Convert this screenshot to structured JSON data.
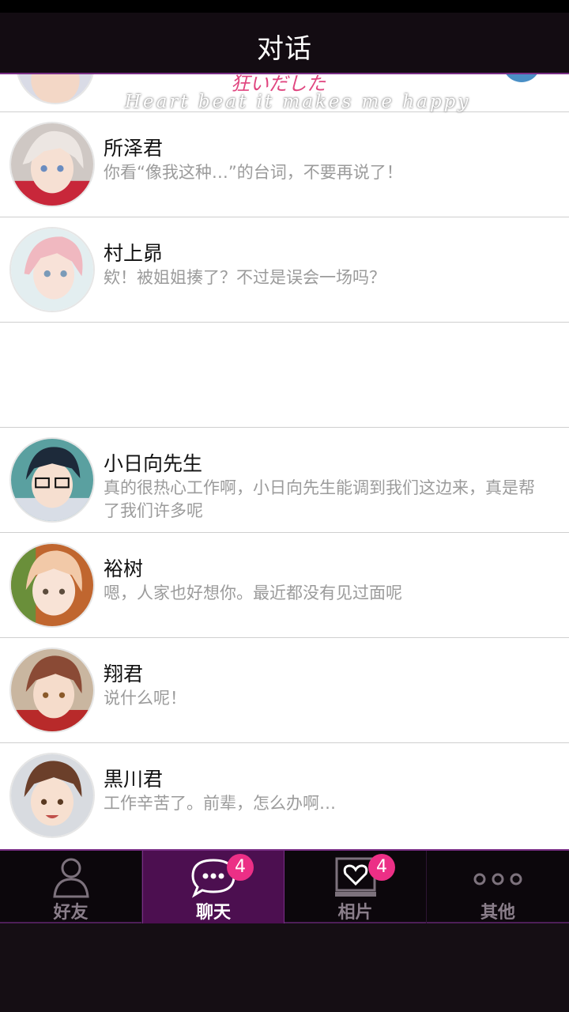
{
  "header": {
    "title": "对话"
  },
  "banner": {
    "jp_text": "狂いだした",
    "en_text": "Heart beat it makes me happy"
  },
  "chats": [
    {
      "name": "所泽君",
      "message": "你看“像我这种…”的台词，不要再说了！"
    },
    {
      "name": "村上昴",
      "message": "欸！被姐姐揍了？不过是误会一场吗？"
    },
    {
      "name": "小日向先生",
      "message": "真的很热心工作啊，小日向先生能调到我们这边来，真是帮了我们许多呢"
    },
    {
      "name": "裕树",
      "message": "嗯，人家也好想你。最近都没有见过面呢"
    },
    {
      "name": "翔君",
      "message": "说什么呢！"
    },
    {
      "name": "黒川君",
      "message": "工作辛苦了。前辈，怎么办啊…"
    }
  ],
  "tabs": [
    {
      "label": "好友",
      "icon": "person-icon",
      "active": false,
      "badge": null
    },
    {
      "label": "聊天",
      "icon": "chat-bubble-icon",
      "active": true,
      "badge": "4"
    },
    {
      "label": "相片",
      "icon": "heart-photo-icon",
      "active": false,
      "badge": "4"
    },
    {
      "label": "其他",
      "icon": "more-dots-icon",
      "active": false,
      "badge": null
    }
  ],
  "colors": {
    "accent": "#7a2f86",
    "active_tab": "#4c0f50",
    "badge": "#ec2f86",
    "header_bg": "#130c12",
    "message_text": "#9b9b9b"
  }
}
